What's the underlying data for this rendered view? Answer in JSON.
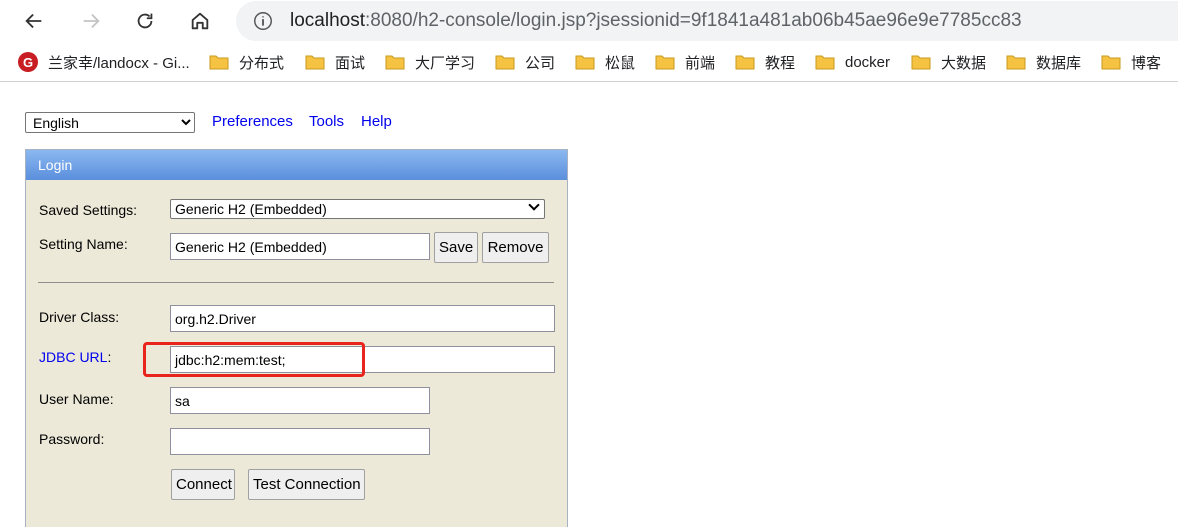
{
  "browser": {
    "url_host": "localhost",
    "url_rest": ":8080/h2-console/login.jsp?jsessionid=9f1841a481ab06b45ae96e9e7785cc83",
    "bookmarks": [
      {
        "label": "兰家幸/landocx - Gi...",
        "icon": "gitee-icon"
      },
      {
        "label": "分布式",
        "icon": "folder-icon"
      },
      {
        "label": "面试",
        "icon": "folder-icon"
      },
      {
        "label": "大厂学习",
        "icon": "folder-icon"
      },
      {
        "label": "公司",
        "icon": "folder-icon"
      },
      {
        "label": "松鼠",
        "icon": "folder-icon"
      },
      {
        "label": "前端",
        "icon": "folder-icon"
      },
      {
        "label": "教程",
        "icon": "folder-icon"
      },
      {
        "label": "docker",
        "icon": "folder-icon"
      },
      {
        "label": "大数据",
        "icon": "folder-icon"
      },
      {
        "label": "数据库",
        "icon": "folder-icon"
      },
      {
        "label": "博客",
        "icon": "folder-icon"
      }
    ],
    "gitee_letter": "G"
  },
  "toolbar": {
    "language": "English",
    "links": [
      "Preferences",
      "Tools",
      "Help"
    ]
  },
  "login": {
    "title": "Login",
    "saved_settings_label": "Saved Settings:",
    "saved_settings_value": "Generic H2 (Embedded)",
    "setting_name_label": "Setting Name:",
    "setting_name_value": "Generic H2 (Embedded)",
    "save_label": "Save",
    "remove_label": "Remove",
    "driver_class_label": "Driver Class:",
    "driver_class_value": "org.h2.Driver",
    "jdbc_url_label": "JDBC URL",
    "jdbc_url_colon": ":",
    "jdbc_url_value": "jdbc:h2:mem:test;",
    "user_name_label": "User Name:",
    "user_name_value": "sa",
    "password_label": "Password:",
    "password_value": "",
    "connect_label": "Connect",
    "test_connection_label": "Test Connection"
  },
  "colors": {
    "link": "#0000ee",
    "panel_bg": "#ece9d8",
    "header_gradient_top": "#8bb8f0",
    "header_gradient_bottom": "#5b8fdd",
    "highlight": "#e8251c",
    "folder": "#f5c242"
  }
}
